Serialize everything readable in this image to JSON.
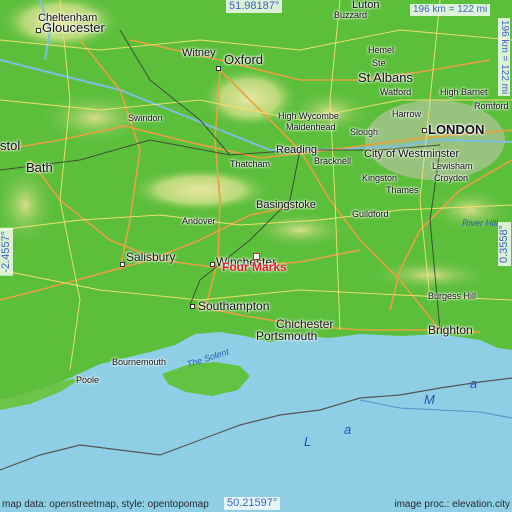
{
  "map": {
    "labels": {
      "cheltenham": "Cheltenham",
      "gloucester": "Gloucester",
      "witney": "Witney",
      "oxford": "Oxford",
      "luton": "Luton",
      "buzzard": "Buzzard",
      "hemel": "Hemel",
      "stevenage": "Ste",
      "st_albans": "St Albans",
      "watford": "Watford",
      "high_barnet": "High Barnet",
      "harrow": "Harrow",
      "romford": "Romford",
      "high_wycombe": "High Wycombe",
      "maidenhead": "Maidenhead",
      "slough": "Slough",
      "london": "LONDON",
      "swindon": "Swindon",
      "bristol": "stol",
      "reading": "Reading",
      "bracknell": "Bracknell",
      "city_westminster": "City of Westminster",
      "lewisham": "Lewisham",
      "thatcham": "Thatcham",
      "kingston": "Kingston",
      "croydon": "Croydon",
      "thames": "Thames",
      "bath": "Bath",
      "basingstoke": "Basingstoke",
      "guildford": "Guildford",
      "river_hill": "River Hill",
      "andover": "Andover",
      "salisbury": "Salisbury",
      "winchester": "Winchester",
      "four_marks": "Four Marks",
      "burgess_hill": "Burgess Hill",
      "southampton": "Southampton",
      "chichester": "Chichester",
      "portsmouth": "Portsmouth",
      "brighton": "Brighton",
      "bournemouth": "Bournemouth",
      "poole": "Poole",
      "the_solent": "The Solent",
      "sea_letters": [
        "L",
        "a",
        "M",
        "a"
      ]
    },
    "coords": {
      "top": "51.98187°",
      "bottom": "50.21597°",
      "left": "-2.4557°",
      "right": "0.3558°"
    },
    "scale": {
      "horizontal": "196 km = 122 mi",
      "vertical": "196 km = 122 mi"
    },
    "credits": {
      "left": "map data: openstreetmap, style: opentopomap",
      "right": "image proc.: elevation.city"
    },
    "colors": {
      "sea": "#8fcfe6",
      "land_low": "#5cbf3c",
      "land_high": "#e3e079",
      "highlight": "#e0202a",
      "coord_text": "#3b63c8"
    },
    "icons": [
      "location-marker-icon"
    ]
  }
}
